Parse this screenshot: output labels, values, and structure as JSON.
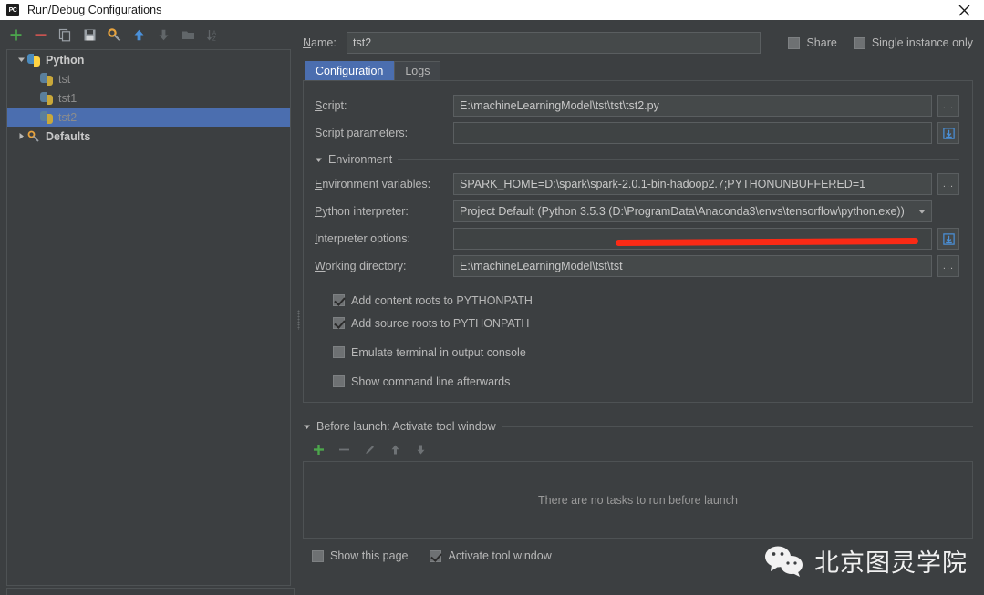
{
  "window": {
    "title": "Run/Debug Configurations",
    "app_badge": "PC",
    "close_label": "Close"
  },
  "toolbar": {
    "items": [
      {
        "name": "add-icon",
        "label": "Add New Configuration",
        "enabled": true
      },
      {
        "name": "remove-icon",
        "label": "Remove Configuration",
        "enabled": true
      },
      {
        "name": "copy-icon",
        "label": "Copy Configuration",
        "enabled": true
      },
      {
        "name": "save-icon",
        "label": "Save Configuration",
        "enabled": true
      },
      {
        "name": "edit-templates-icon",
        "label": "Edit Templates",
        "enabled": true
      },
      {
        "name": "move-up-icon",
        "label": "Move Up",
        "enabled": true
      },
      {
        "name": "move-down-icon",
        "label": "Move Down",
        "enabled": false
      },
      {
        "name": "folder-icon",
        "label": "Create New Folder",
        "enabled": false
      },
      {
        "name": "sort-alphabetically-icon",
        "label": "Sort Configurations",
        "enabled": false
      }
    ]
  },
  "tree": {
    "nodes": [
      {
        "label": "Python",
        "level": 0,
        "expanded": true,
        "selected": false,
        "icon": "python-icon"
      },
      {
        "label": "tst",
        "level": 1,
        "expanded": null,
        "selected": false,
        "icon": "python-icon"
      },
      {
        "label": "tst1",
        "level": 1,
        "expanded": null,
        "selected": false,
        "icon": "python-icon"
      },
      {
        "label": "tst2",
        "level": 1,
        "expanded": null,
        "selected": true,
        "icon": "python-icon"
      },
      {
        "label": "Defaults",
        "level": 0,
        "expanded": false,
        "selected": false,
        "icon": "defaults-icon"
      }
    ]
  },
  "header": {
    "name_label": "Name:",
    "name_value": "tst2",
    "share_label": "Share",
    "share_checked": false,
    "single_instance_label": "Single instance only",
    "single_instance_checked": false
  },
  "tabs": [
    {
      "label": "Configuration",
      "active": true
    },
    {
      "label": "Logs",
      "active": false
    }
  ],
  "form": {
    "script": {
      "label": "Script:",
      "value": "E:\\machineLearningModel\\tst\\tst\\tst2.py",
      "browse_label": "..."
    },
    "script_parameters": {
      "label": "Script parameters:",
      "value": "",
      "macro_icon": "insert-macro-icon"
    },
    "environment_section": {
      "label": "Environment",
      "expanded": true
    },
    "environment_variables": {
      "label": "Environment variables:",
      "value": "SPARK_HOME=D:\\spark\\spark-2.0.1-bin-hadoop2.7;PYTHONUNBUFFERED=1",
      "browse_label": "..."
    },
    "python_interpreter": {
      "label": "Python interpreter:",
      "value": "Project Default (Python 3.5.3 (D:\\ProgramData\\Anaconda3\\envs\\tensorflow\\python.exe))",
      "dropdown_icon": "chevron-down-icon"
    },
    "interpreter_options": {
      "label": "Interpreter options:",
      "value": "",
      "macro_icon": "insert-macro-icon"
    },
    "working_directory": {
      "label": "Working directory:",
      "value": "E:\\machineLearningModel\\tst\\tst",
      "browse_label": "..."
    },
    "checkboxes": [
      {
        "label": "Add content roots to PYTHONPATH",
        "checked": true
      },
      {
        "label": "Add source roots to PYTHONPATH",
        "checked": true
      },
      {
        "label": "Emulate terminal in output console",
        "checked": false
      },
      {
        "label": "Show command line afterwards",
        "checked": false
      }
    ]
  },
  "before_launch": {
    "header": "Before launch: Activate tool window",
    "expanded": true,
    "toolbar": [
      {
        "name": "add-task-icon",
        "label": "Add Task",
        "enabled": true
      },
      {
        "name": "remove-task-icon",
        "label": "Remove Task",
        "enabled": false
      },
      {
        "name": "edit-task-icon",
        "label": "Edit Task",
        "enabled": false
      },
      {
        "name": "move-task-up-icon",
        "label": "Move Up",
        "enabled": false
      },
      {
        "name": "move-task-down-icon",
        "label": "Move Down",
        "enabled": false
      }
    ],
    "empty_message": "There are no tasks to run before launch",
    "show_this_page": {
      "label": "Show this page",
      "checked": false
    },
    "activate_tool_window": {
      "label": "Activate tool window",
      "checked": true
    }
  },
  "annotation": {
    "type": "red-underline",
    "color": "#fb2a15",
    "targets": "python_interpreter path"
  },
  "watermark": {
    "text": "北京图灵学院",
    "icon": "wechat-icon"
  },
  "colors": {
    "window_bg": "#3c3f41",
    "titlebar_bg": "#ffffff",
    "selection_blue": "#4b6eaf",
    "border": "#4e5254",
    "text": "#b8b8b8",
    "accent_red": "#fb2a15",
    "accent_green": "#4ca64c"
  }
}
